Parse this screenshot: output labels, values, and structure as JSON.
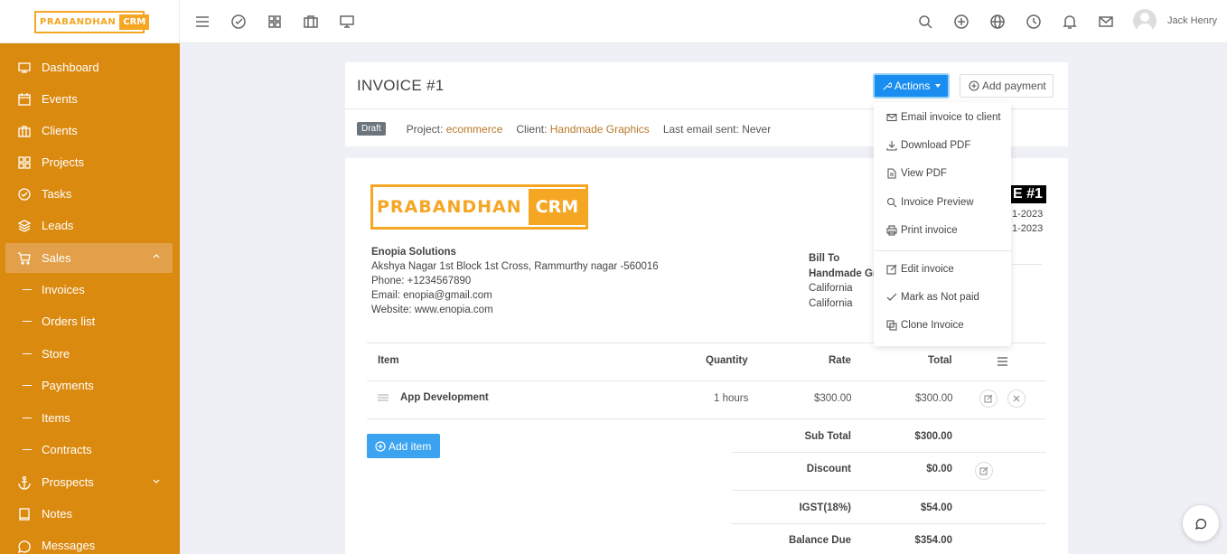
{
  "brand": {
    "part1": "PRABANDHAN",
    "part2": "CRM"
  },
  "topbar": {
    "icons": [
      "menu-icon",
      "check-circle-icon",
      "grid-icon",
      "briefcase-icon",
      "monitor-icon"
    ],
    "right_icons": [
      "search-icon",
      "plus-circle-icon",
      "globe-icon",
      "clock-icon",
      "bell-icon",
      "mail-icon"
    ],
    "user_name": "Jack Henry"
  },
  "sidebar": {
    "items": [
      {
        "label": "Dashboard",
        "icon": "monitor-icon"
      },
      {
        "label": "Events",
        "icon": "calendar-icon"
      },
      {
        "label": "Clients",
        "icon": "briefcase-icon"
      },
      {
        "label": "Projects",
        "icon": "grid-icon"
      },
      {
        "label": "Tasks",
        "icon": "check-circle-icon"
      },
      {
        "label": "Leads",
        "icon": "layers-icon"
      },
      {
        "label": "Sales",
        "icon": "cart-icon"
      },
      {
        "label": "Invoices"
      },
      {
        "label": "Orders list"
      },
      {
        "label": "Store"
      },
      {
        "label": "Payments"
      },
      {
        "label": "Items"
      },
      {
        "label": "Contracts"
      },
      {
        "label": "Prospects",
        "icon": "anchor-icon"
      },
      {
        "label": "Notes",
        "icon": "book-icon"
      },
      {
        "label": "Messages",
        "icon": "message-icon"
      }
    ]
  },
  "invoice": {
    "title": "INVOICE #1",
    "actions_label": "Actions",
    "add_payment_label": "Add payment",
    "status": "Draft",
    "project_label": "Project:",
    "project": "ecommerce",
    "client_label": "Client:",
    "client": "Handmade Graphics",
    "last_email_label": "Last email sent:",
    "last_email": "Never",
    "badge": "E #1",
    "date1": "1-2023",
    "date2": "1-2023"
  },
  "company": {
    "name": "Enopia Solutions",
    "address": "Akshya Nagar 1st Block 1st Cross, Rammurthy nagar -560016",
    "phone": "Phone: +1234567890",
    "email": "Email: enopia@gmail.com",
    "website": "Website: www.enopia.com"
  },
  "bill_to": {
    "label": "Bill To",
    "name": "Handmade Gr",
    "line1": "California",
    "line2": "California"
  },
  "table": {
    "headers": {
      "item": "Item",
      "quantity": "Quantity",
      "rate": "Rate",
      "total": "Total"
    },
    "rows": [
      {
        "item": "App Development",
        "quantity": "1 hours",
        "rate": "$300.00",
        "total": "$300.00"
      }
    ],
    "add_item_label": "Add item"
  },
  "summary": {
    "sub_total_label": "Sub Total",
    "sub_total": "$300.00",
    "discount_label": "Discount",
    "discount": "$0.00",
    "tax_label": "IGST(18%)",
    "tax": "$54.00",
    "balance_label": "Balance Due",
    "balance": "$354.00"
  },
  "actions_menu": {
    "items": [
      {
        "label": "Email invoice to client",
        "icon": "mail-icon"
      },
      {
        "label": "Download PDF",
        "icon": "download-icon"
      },
      {
        "label": "View PDF",
        "icon": "file-icon"
      },
      {
        "label": "Invoice Preview",
        "icon": "search-icon"
      },
      {
        "label": "Print invoice",
        "icon": "printer-icon"
      },
      {
        "label": "Edit invoice",
        "icon": "edit-icon"
      },
      {
        "label": "Mark as Not paid",
        "icon": "check-icon"
      },
      {
        "label": "Clone Invoice",
        "icon": "copy-icon"
      }
    ]
  },
  "colors": {
    "sidebar": "#db8a10",
    "accent": "#1a8ef0",
    "brand_orange": "#f5a623",
    "link": "#b9772a"
  }
}
